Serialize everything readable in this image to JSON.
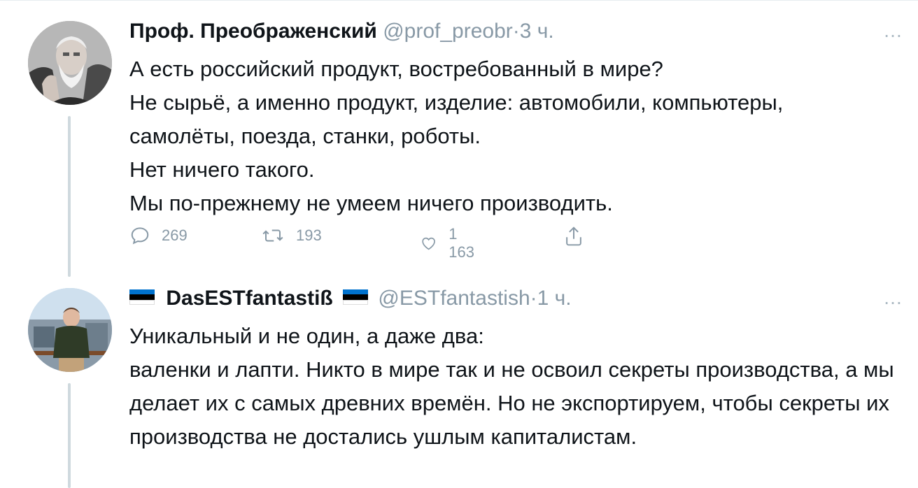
{
  "tweet1": {
    "name": "Проф. Преображенский",
    "handle": "@prof_preobr",
    "separator": "·",
    "time": "3 ч.",
    "lines": [
      "А есть российский продукт, востребованный в мире?",
      "Не сырьё, а именно продукт, изделие: автомобили, компьютеры, самолёты, поезда, станки, роботы.",
      "Нет ничего такого.",
      "Мы по-прежнему не умеем ничего производить."
    ],
    "replies": "269",
    "retweets": "193",
    "likes": "1 163"
  },
  "tweet2": {
    "name": "DasESTfantastiß",
    "handle": "@ESTfantastish",
    "separator": "·",
    "time": "1 ч.",
    "lines": [
      "Уникальный и не один, а даже два:",
      "валенки и лапти. Никто в мире так и не освоил секреты производства, а мы делает их с самых древних времён. Но не экспортируем, чтобы секреты их производства не достались ушлым капиталистам."
    ]
  },
  "more_icon": "…",
  "icons": [
    "reply-icon",
    "retweet-icon",
    "like-icon",
    "share-icon",
    "estonian-flag-icon"
  ],
  "colors": {
    "secondary_text": "#8899a6",
    "flag_blue": "#0072ce",
    "flag_black": "#000000",
    "flag_white": "#ffffff"
  }
}
